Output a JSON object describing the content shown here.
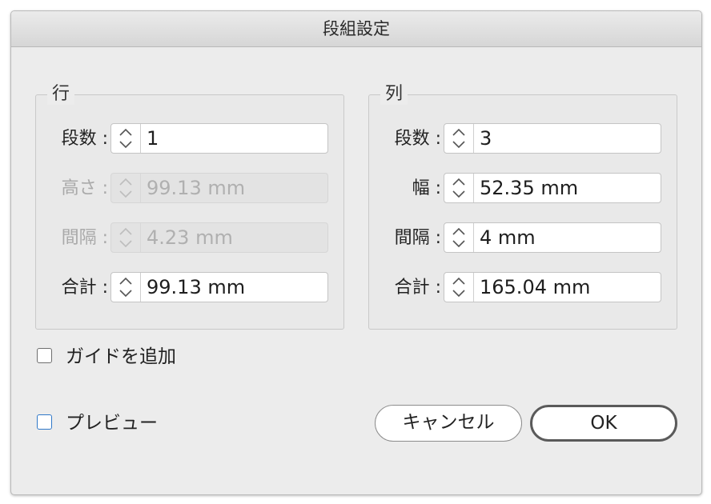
{
  "window": {
    "title": "段組設定"
  },
  "rows_group": {
    "legend": "行",
    "fields": [
      {
        "label": "段数 :",
        "value": "1",
        "disabled": false
      },
      {
        "label": "高さ :",
        "value": "99.13 mm",
        "disabled": true
      },
      {
        "label": "間隔 :",
        "value": "4.23 mm",
        "disabled": true
      },
      {
        "label": "合計 :",
        "value": "99.13 mm",
        "disabled": false
      }
    ]
  },
  "columns_group": {
    "legend": "列",
    "fields": [
      {
        "label": "段数 :",
        "value": "3",
        "disabled": false
      },
      {
        "label": "幅 :",
        "value": "52.35 mm",
        "disabled": false
      },
      {
        "label": "間隔 :",
        "value": "4 mm",
        "disabled": false
      },
      {
        "label": "合計 :",
        "value": "165.04 mm",
        "disabled": false
      }
    ]
  },
  "options": {
    "add_guides_label": "ガイドを追加",
    "add_guides_checked": false,
    "preview_label": "プレビュー",
    "preview_checked": false
  },
  "buttons": {
    "cancel_label": "キャンセル",
    "ok_label": "OK"
  },
  "icons": {
    "stepper": "up-down-chevron-icon",
    "checkbox": "checkbox-icon"
  },
  "colors": {
    "dialog_bg": "#ececec",
    "disabled_text": "#a9a9a9",
    "preview_checkbox_border": "#2f78c8"
  }
}
